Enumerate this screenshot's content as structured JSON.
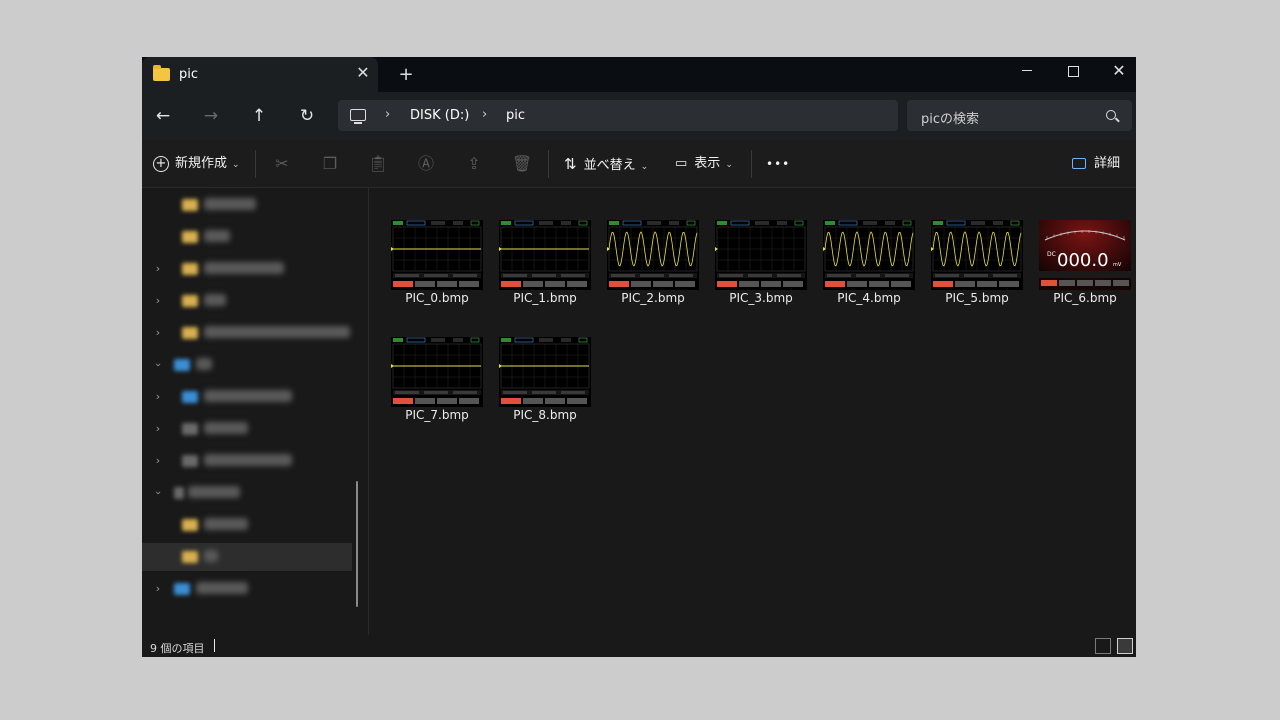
{
  "tab": {
    "title": "pic"
  },
  "address": {
    "crumbs": [
      "DISK (D:)",
      "pic"
    ]
  },
  "search": {
    "placeholder": "picの検索"
  },
  "commands": {
    "new_label": "新規作成",
    "sort_label": "並べ替え",
    "view_label": "表示",
    "details_label": "詳細",
    "more_label": "•••"
  },
  "files": [
    {
      "name": "PIC_0.bmp",
      "kind": "flat"
    },
    {
      "name": "PIC_1.bmp",
      "kind": "flat"
    },
    {
      "name": "PIC_2.bmp",
      "kind": "sine"
    },
    {
      "name": "PIC_3.bmp",
      "kind": "empty"
    },
    {
      "name": "PIC_4.bmp",
      "kind": "sine"
    },
    {
      "name": "PIC_5.bmp",
      "kind": "sine"
    },
    {
      "name": "PIC_6.bmp",
      "kind": "meter",
      "reading": "000.0",
      "unit": "mV",
      "mode": "DC"
    },
    {
      "name": "PIC_7.bmp",
      "kind": "flat"
    },
    {
      "name": "PIC_8.bmp",
      "kind": "flat"
    }
  ],
  "status": {
    "item_count": "9 個の項目"
  },
  "colors": {
    "accent_folder": "#f4c542",
    "window_bg": "#191919",
    "trace": "#e8e04a",
    "soft_key": "#e0503a"
  },
  "icons": [
    "folder-icon",
    "close-icon",
    "plus-icon",
    "back-arrow-icon",
    "forward-arrow-icon",
    "up-arrow-icon",
    "refresh-icon",
    "pc-icon",
    "search-icon",
    "cut-icon",
    "copy-icon",
    "paste-icon",
    "rename-icon",
    "share-icon",
    "delete-icon",
    "sort-icon",
    "view-icon",
    "details-pane-icon"
  ]
}
